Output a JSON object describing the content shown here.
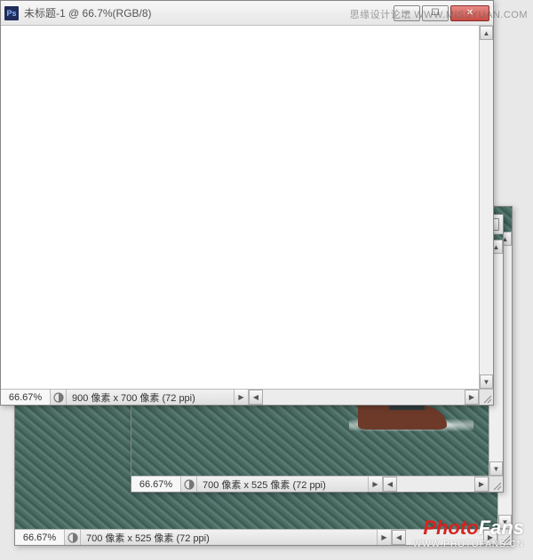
{
  "top_watermark": "思缘设计论坛  WWW.MISSYUAN.COM",
  "bottom_watermark": {
    "logo_red": "Photo",
    "logo_white": "Fans",
    "url": "WWW.PHOTOFANS.CN"
  },
  "windows": {
    "front": {
      "app_icon_text": "Ps",
      "title": "未标题-1 @ 66.7%(RGB/8)",
      "status_zoom": "66.67%",
      "status_info": "900 像素 x 700 像素 (72 ppi)",
      "win_min_glyph": "─",
      "win_max_glyph": "☐",
      "win_close_glyph": "✕",
      "scroll_right_glyph": "▶",
      "scroll_left_glyph": "◀",
      "scroll_up_glyph": "▲",
      "scroll_down_glyph": "▼"
    },
    "mid": {
      "restore_glyph": "⧉",
      "status_zoom": "66.67%",
      "status_info": "700 像素 x 525 像素 (72 ppi)",
      "scroll_right_glyph": "▶",
      "scroll_left_glyph": "◀",
      "scroll_up_glyph": "▲",
      "scroll_down_glyph": "▼"
    },
    "back": {
      "status_zoom": "66.67%",
      "status_info": "700 像素 x 525 像素 (72 ppi)",
      "scroll_right_glyph": "▶",
      "scroll_left_glyph": "◀",
      "scroll_up_glyph": "▲",
      "scroll_down_glyph": "▼"
    }
  }
}
